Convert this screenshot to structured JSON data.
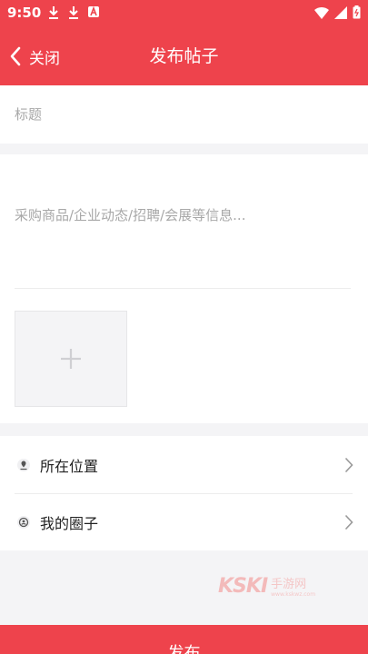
{
  "status_bar": {
    "time": "9:50"
  },
  "header": {
    "back_label": "关闭",
    "title": "发布帖子"
  },
  "form": {
    "title_placeholder": "标题",
    "content_placeholder": "采购商品/企业动态/招聘/会展等信息..."
  },
  "options": [
    {
      "label": "所在位置",
      "icon": "location-icon"
    },
    {
      "label": "我的圈子",
      "icon": "circle-group-icon"
    }
  ],
  "watermark": {
    "logo": "KSKI",
    "text": "手游网",
    "domain": "www.kskwz.com"
  },
  "footer": {
    "publish_label": "发布"
  },
  "colors": {
    "brand": "#ee434c",
    "background": "#f4f4f6"
  }
}
